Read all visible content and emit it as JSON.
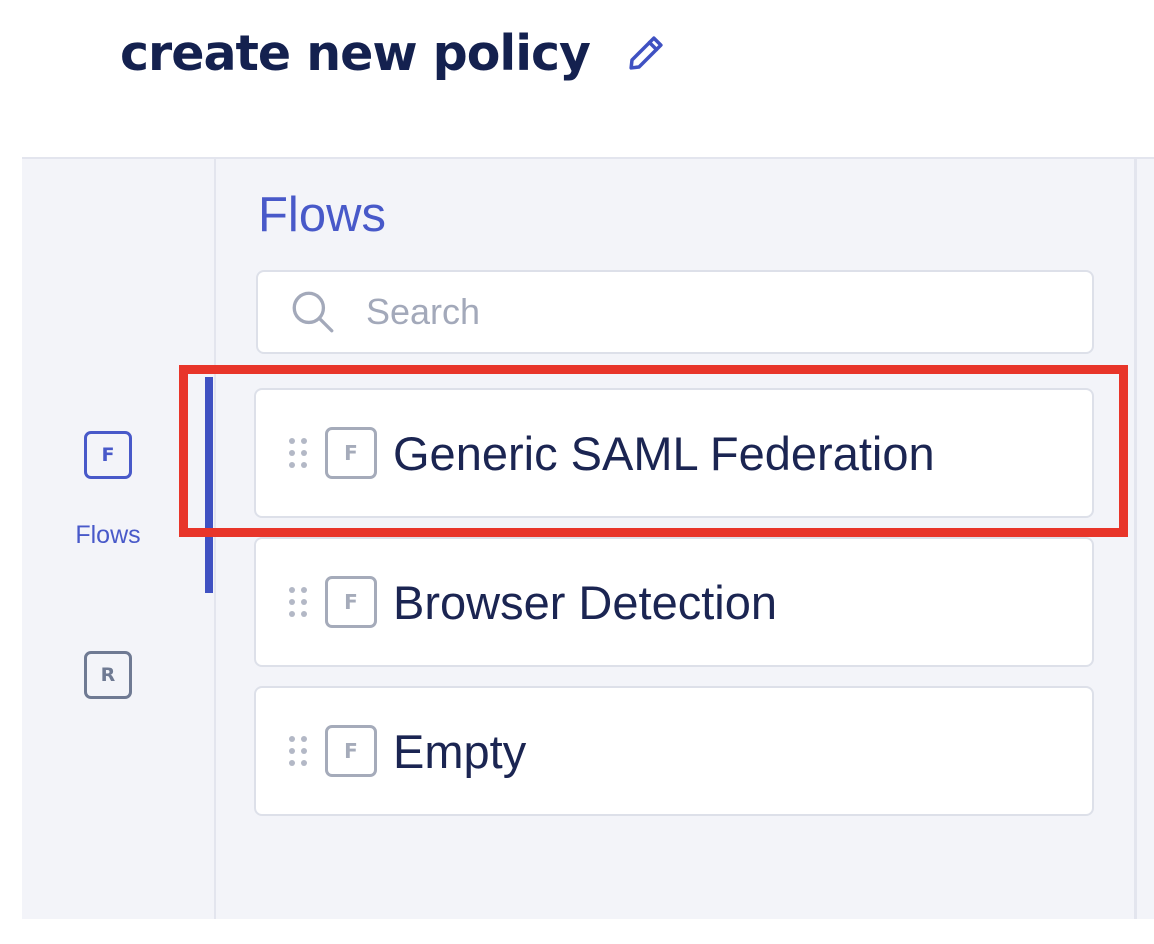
{
  "header": {
    "title": "create new policy"
  },
  "rail": {
    "items": [
      {
        "badge": "F",
        "label": "Flows",
        "active": true
      },
      {
        "badge": "R",
        "label": "",
        "active": false
      }
    ]
  },
  "panel": {
    "title": "Flows",
    "search": {
      "placeholder": "Search",
      "value": ""
    },
    "flows": [
      {
        "badge": "F",
        "name": "Generic SAML Federation",
        "highlighted": true
      },
      {
        "badge": "F",
        "name": "Browser Detection",
        "highlighted": false
      },
      {
        "badge": "F",
        "name": "Empty",
        "highlighted": false
      }
    ]
  },
  "colors": {
    "accent": "#4859c9",
    "title_text": "#14214f",
    "highlight": "#e8352a",
    "panel_bg": "#f3f4f9"
  },
  "icons": {
    "edit": "pencil-icon",
    "search": "search-icon",
    "drag": "drag-handle-icon"
  }
}
